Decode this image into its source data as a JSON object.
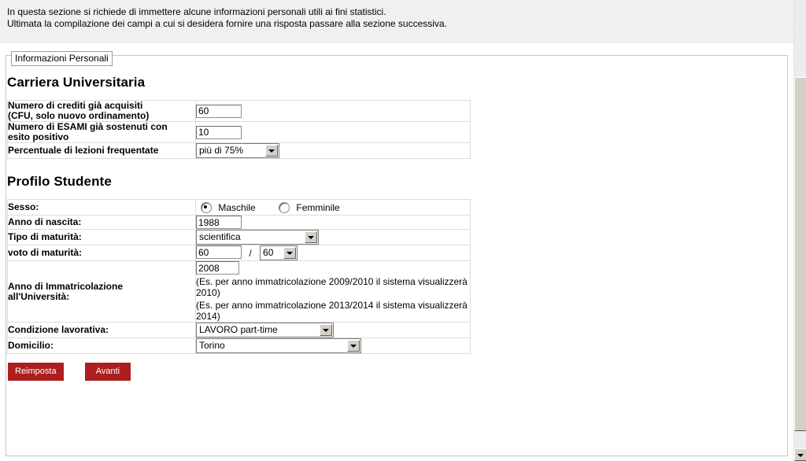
{
  "banner": {
    "line1": "In questa sezione si richiede di immettere alcune informazioni personali utili ai fini statistici.",
    "line2": "Ultimata la compilazione dei campi a cui si desidera fornire una risposta passare alla sezione successiva."
  },
  "fieldset": {
    "legend": "Informazioni Personali"
  },
  "sections": {
    "carriera": {
      "title": "Carriera Universitaria",
      "rows": [
        {
          "label_line1": "Numero di crediti già acquisiti",
          "label_line2": "(CFU, solo nuovo ordinamento)",
          "value": "60",
          "type": "text"
        },
        {
          "label_line1": "Numero di ESAMI già sostenuti con",
          "label_line2": "esito positivo",
          "value": "10",
          "type": "text"
        },
        {
          "label_line1": "Percentuale di lezioni frequentate",
          "label_line2": "",
          "value": "più di 75%",
          "type": "select"
        }
      ]
    },
    "profilo": {
      "title": "Profilo Studente",
      "sesso": {
        "label": "Sesso:",
        "options": [
          {
            "label": "Maschile",
            "checked": true
          },
          {
            "label": "Femminile",
            "checked": false
          }
        ]
      },
      "anno_nascita": {
        "label": "Anno di nascita:",
        "value": "1988"
      },
      "tipo_maturita": {
        "label": "Tipo di maturità:",
        "value": "scientifica"
      },
      "voto_maturita": {
        "label": "voto di maturità:",
        "value": "60",
        "separator": "/",
        "base": "60"
      },
      "immatricolazione": {
        "label_line1": "Anno di Immatricolazione",
        "label_line2": "all'Università:",
        "value": "2008",
        "hint1": "(Es. per anno immatricolazione 2009/2010 il sistema visualizzerà 2010)",
        "hint2": "(Es. per anno immatricolazione 2013/2014 il sistema visualizzerà 2014)"
      },
      "condizione": {
        "label": "Condizione lavorativa:",
        "value": "LAVORO part-time"
      },
      "domicilio": {
        "label": "Domicilio:",
        "value": "Torino"
      }
    }
  },
  "buttons": {
    "reset_label": "Reimposta",
    "next_label": "Avanti",
    "accent_color": "#ad1f1f"
  }
}
